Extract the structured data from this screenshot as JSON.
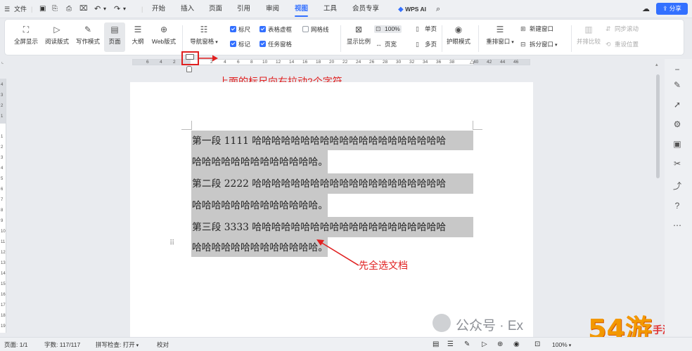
{
  "titlebar": {
    "menu_icon": "hamburger-icon",
    "file_label": "文件",
    "tabs": [
      {
        "label": "开始"
      },
      {
        "label": "插入"
      },
      {
        "label": "页面"
      },
      {
        "label": "引用"
      },
      {
        "label": "审阅"
      },
      {
        "label": "视图"
      },
      {
        "label": "工具"
      },
      {
        "label": "会员专享"
      }
    ],
    "active_tab": "视图",
    "wps_ai_label": "WPS AI",
    "share_label": "分享",
    "accent_color": "#3370ff"
  },
  "ribbon": {
    "view_buttons": [
      {
        "label": "全屏显示",
        "icon": "fullscreen-icon"
      },
      {
        "label": "阅读版式",
        "icon": "read-mode-icon"
      },
      {
        "label": "写作模式",
        "icon": "pen-icon"
      },
      {
        "label": "页面",
        "icon": "page-view-icon",
        "selected": true
      },
      {
        "label": "大纲",
        "icon": "outline-icon"
      },
      {
        "label": "Web版式",
        "icon": "globe-icon"
      }
    ],
    "nav_pane_label": "导航窗格",
    "checkboxes": [
      {
        "label": "标尺",
        "checked": true
      },
      {
        "label": "表格虚框",
        "checked": true
      },
      {
        "label": "网格线",
        "checked": false
      },
      {
        "label": "标记",
        "checked": true
      },
      {
        "label": "任务窗格",
        "checked": true
      }
    ],
    "zoom_ratio_label": "显示比例",
    "zoom_100_label": "100%",
    "page_width_label": "页宽",
    "single_page_label": "单页",
    "multi_page_label": "多页",
    "eye_mode_label": "护眼模式",
    "rearrange_label": "重排窗口",
    "new_window_label": "新建窗口",
    "split_window_label": "拆分窗口",
    "compare_label": "并排比较",
    "sync_scroll_label": "同步滚动",
    "reset_position_label": "重设位置"
  },
  "ruler": {
    "labels": [
      "6",
      "4",
      "2",
      "2",
      "4",
      "6",
      "8",
      "10",
      "12",
      "14",
      "16",
      "18",
      "20",
      "22",
      "24",
      "26",
      "28",
      "30",
      "32",
      "34",
      "36",
      "38",
      "40",
      "42",
      "44",
      "46"
    ]
  },
  "vruler": {
    "labels": [
      "4",
      "3",
      "2",
      "1",
      "1",
      "2",
      "3",
      "4",
      "5",
      "6",
      "7",
      "8",
      "9",
      "10",
      "11",
      "12",
      "13",
      "14",
      "15",
      "16",
      "17",
      "18",
      "19"
    ]
  },
  "document": {
    "lines": [
      "第一段 1111 哈哈哈哈哈哈哈哈哈哈哈哈哈哈哈哈哈哈哈哈",
      "哈哈哈哈哈哈哈哈哈哈哈哈哈。",
      "第二段 2222 哈哈哈哈哈哈哈哈哈哈哈哈哈哈哈哈哈哈哈哈",
      "哈哈哈哈哈哈哈哈哈哈哈哈哈。",
      "第三段 3333 哈哈哈哈哈哈哈哈哈哈哈哈哈哈哈哈哈哈哈哈",
      "哈哈哈哈哈哈哈哈哈哈哈哈哈。"
    ],
    "selection_color": "#c8c8c8"
  },
  "annotations": {
    "ruler_note": "上面的标尺向右拉动2个字符",
    "select_note": "先全选文档",
    "color": "#e02020"
  },
  "statusbar": {
    "page_label": "页面: 1/1",
    "word_count_label": "字数: 117/117",
    "spell_check_label": "拼写检查: 打开",
    "proofread_label": "校对",
    "zoom_label": "100%"
  },
  "watermark": {
    "wechat_text": "公众号 · Ex",
    "site_logo": "54游",
    "site_name": "手游网"
  }
}
